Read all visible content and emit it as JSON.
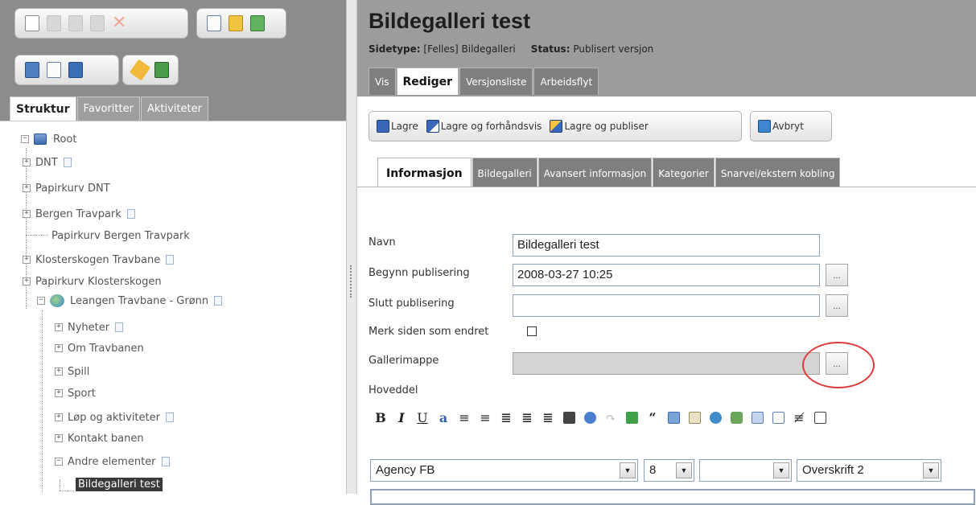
{
  "left": {
    "tabs": [
      "Struktur",
      "Favoritter",
      "Aktiviteter"
    ],
    "tree": [
      {
        "label": "Root"
      },
      {
        "label": "DNT"
      },
      {
        "label": "Papirkurv DNT"
      },
      {
        "label": "Bergen Travpark"
      },
      {
        "label": "Papirkurv Bergen Travpark"
      },
      {
        "label": "Klosterskogen Travbane"
      },
      {
        "label": "Papirkurv Klosterskogen"
      },
      {
        "label": "Leangen Travbane - Grønn"
      },
      {
        "label": "Nyheter"
      },
      {
        "label": "Om Travbanen"
      },
      {
        "label": "Spill"
      },
      {
        "label": "Sport"
      },
      {
        "label": "Løp og aktiviteter"
      },
      {
        "label": "Kontakt banen"
      },
      {
        "label": "Andre elementer"
      },
      {
        "label": "Bildegalleri test"
      }
    ]
  },
  "header": {
    "title": "Bildegalleri test",
    "sidetype_label": "Sidetype:",
    "sidetype_value": "[Felles] Bildegalleri",
    "status_label": "Status:",
    "status_value": "Publisert versjon",
    "tabs": [
      "Vis",
      "Rediger",
      "Versjonsliste",
      "Arbeidsflyt"
    ]
  },
  "toolbar": {
    "save": "Lagre",
    "save_preview": "Lagre og forhåndsvis",
    "save_publish": "Lagre og publiser",
    "cancel": "Avbryt"
  },
  "edit_tabs": [
    "Informasjon",
    "Bildegalleri",
    "Avansert informasjon",
    "Kategorier",
    "Snarvei/ekstern kobling"
  ],
  "form": {
    "name_label": "Navn",
    "name_value": "Bildegalleri test",
    "start_label": "Begynn publisering",
    "start_value": "2008-03-27 10:25",
    "end_label": "Slutt publisering",
    "end_value": "",
    "changed_label": "Merk siden som endret",
    "gallery_label": "Gallerimappe",
    "gallery_value": "",
    "body_label": "Hoveddel",
    "browse_label": "..."
  },
  "editor": {
    "font": "Agency FB",
    "size": "8",
    "style_blank": "",
    "format": "Overskrift 2"
  }
}
